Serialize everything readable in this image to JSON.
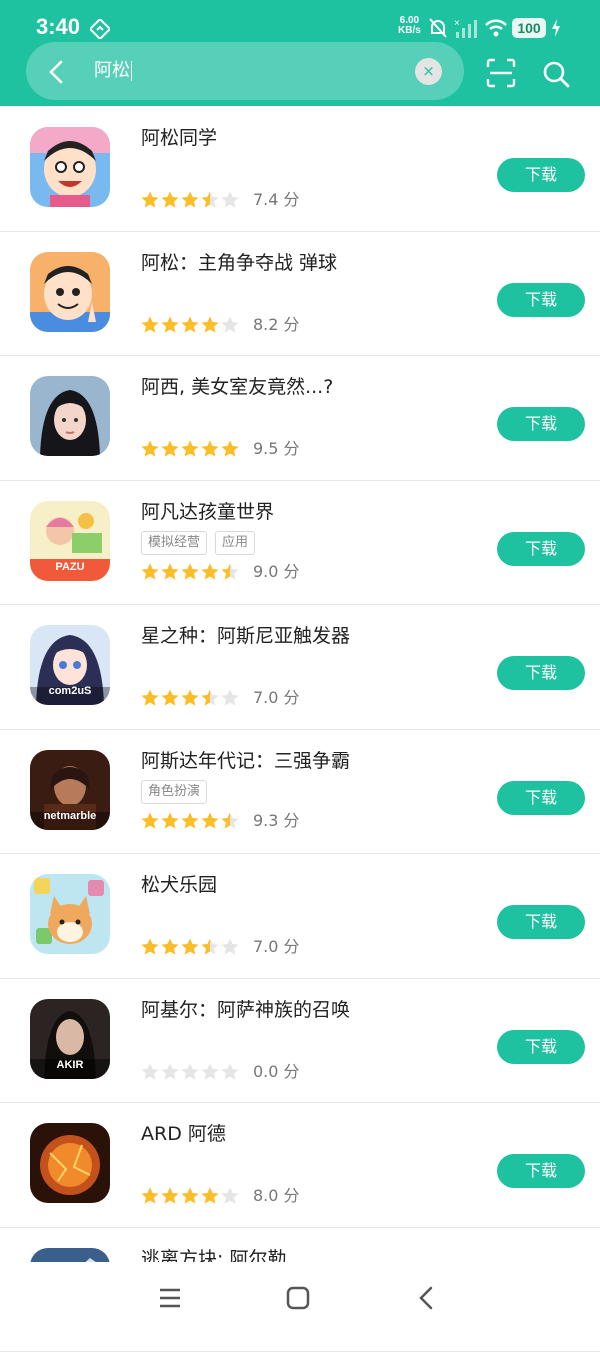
{
  "status_bar": {
    "time": "3:40",
    "net_speed_value": "6.00",
    "net_speed_unit": "KB/s",
    "battery": "100"
  },
  "search": {
    "query": "阿松"
  },
  "download_label": "下载",
  "colors": {
    "accent": "#1ec1a0",
    "star_on": "#fbbd28",
    "star_off": "#e5e5e5"
  },
  "apps": [
    {
      "name": "阿松同学",
      "tags": [],
      "rating": 3.5,
      "score": "7.4 分",
      "icon": "cartoon-boy-icon"
    },
    {
      "name": "阿松：主角争夺战 弹球",
      "tags": [],
      "rating": 4,
      "score": "8.2 分",
      "icon": "cartoon-boy-peace-icon"
    },
    {
      "name": "阿西, 美女室友竟然...?",
      "tags": [],
      "rating": 5,
      "score": "9.5 分",
      "icon": "girl-portrait-icon"
    },
    {
      "name": "阿凡达孩童世界",
      "tags": [
        "模拟经营",
        "应用"
      ],
      "rating": 4.5,
      "score": "9.0 分",
      "icon": "pazu-kids-icon",
      "icon_label": "PAZU"
    },
    {
      "name": "星之种：阿斯尼亚触发器",
      "tags": [],
      "rating": 3.5,
      "score": "7.0 分",
      "icon": "anime-girl-icon",
      "icon_label": "com2uS"
    },
    {
      "name": "阿斯达年代记：三强争霸",
      "tags": [
        "角色扮演"
      ],
      "rating": 4.5,
      "score": "9.3 分",
      "icon": "warrior-icon",
      "icon_label": "netmarble"
    },
    {
      "name": "松犬乐园",
      "tags": [],
      "rating": 3.5,
      "score": "7.0 分",
      "icon": "shiba-dog-icon"
    },
    {
      "name": "阿基尔：阿萨神族的召唤",
      "tags": [],
      "rating": 0,
      "score": "0.0 分",
      "icon": "akir-warrior-icon",
      "icon_label": "AKIR"
    },
    {
      "name": "ARD 阿德",
      "tags": [],
      "rating": 4,
      "score": "8.0 分",
      "icon": "planet-fire-icon"
    },
    {
      "name": "逃离方块: 阿尔勒",
      "tags": [],
      "rating": 0,
      "score": "",
      "icon": "landscape-icon"
    }
  ]
}
